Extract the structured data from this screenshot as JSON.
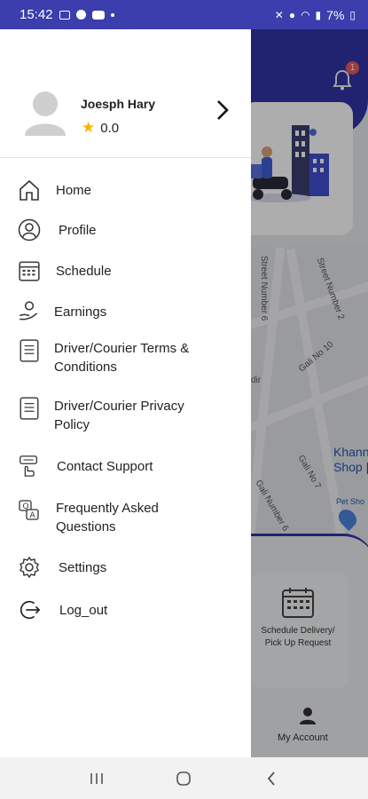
{
  "status_bar": {
    "time": "15:42",
    "battery": "7%"
  },
  "drawer": {
    "user_name": "Joesph Hary",
    "rating": "0.0",
    "menu": [
      {
        "label": "Home",
        "icon": "home-icon"
      },
      {
        "label": "Profile",
        "icon": "profile-icon"
      },
      {
        "label": "Schedule",
        "icon": "calendar-icon"
      },
      {
        "label": "Earnings",
        "icon": "earnings-icon"
      },
      {
        "label": "Driver/Courier Terms & Conditions",
        "icon": "document-icon"
      },
      {
        "label": "Driver/Courier Privacy Policy",
        "icon": "document-icon"
      },
      {
        "label": "Contact Support",
        "icon": "support-icon"
      },
      {
        "label": "Frequently Asked Questions",
        "icon": "faq-icon"
      },
      {
        "label": "Settings",
        "icon": "gear-icon"
      },
      {
        "label": "Log_out",
        "icon": "logout-icon"
      }
    ]
  },
  "background_app": {
    "notification_count": "1",
    "map_labels": [
      "Street Number 6",
      "Street Number 2",
      "Gali No 10",
      "dir",
      "Gali No 7",
      "Gali Number 6"
    ],
    "shop_label": "Khann Shop |",
    "pet_label": "Pet Sho",
    "schedule_card_label": "Schedule Delivery/ Pick Up Request",
    "account_label": "My Account"
  },
  "colors": {
    "brand": "#3234a6",
    "star": "#f5b400"
  }
}
